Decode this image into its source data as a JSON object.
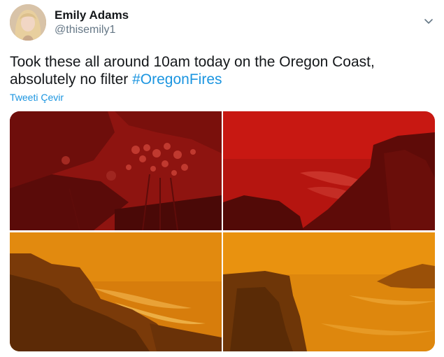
{
  "tweet": {
    "author_name": "Emily Adams",
    "author_handle": "@thisemily1",
    "text": "Took these all around 10am today on the Oregon Coast, absolutely no filter ",
    "hashtag": "#OregonFires",
    "translate_label": "Tweeti Çevir"
  },
  "icons": {
    "menu": "chevron-down-icon",
    "avatar": "avatar"
  },
  "colors": {
    "text": "#14171a",
    "muted": "#657786",
    "link": "#1b95e0"
  },
  "photos": [
    {
      "name": "photo-red-flowers"
    },
    {
      "name": "photo-red-cliff-sea"
    },
    {
      "name": "photo-orange-rocks-surf"
    },
    {
      "name": "photo-orange-cliff-sea"
    }
  ]
}
